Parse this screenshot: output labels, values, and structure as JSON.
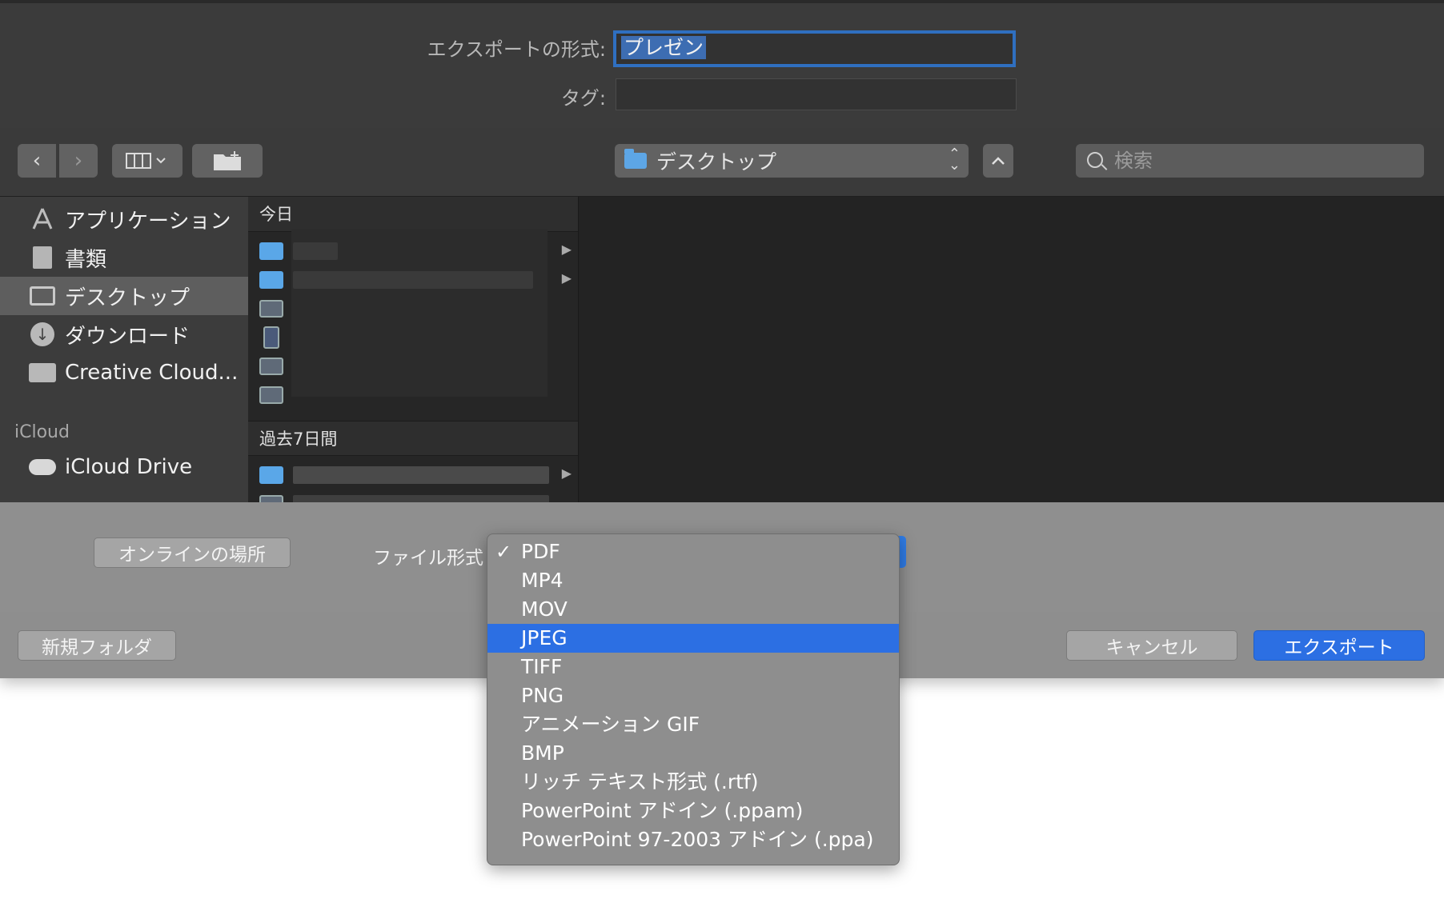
{
  "header": {
    "export_as_label": "エクスポートの形式:",
    "export_name": "プレゼン",
    "tags_label": "タグ:",
    "tags_value": ""
  },
  "toolbar": {
    "back_glyph": "‹",
    "forward_glyph": "›",
    "view_glyph": "▥⌄",
    "location": "デスクトップ",
    "search_placeholder": "検索"
  },
  "sidebar": {
    "items": [
      {
        "label": "アプリケーション",
        "icon": "applications-icon"
      },
      {
        "label": "書類",
        "icon": "documents-icon"
      },
      {
        "label": "デスクトップ",
        "icon": "desktop-icon"
      },
      {
        "label": "ダウンロード",
        "icon": "downloads-icon"
      },
      {
        "label": "Creative Cloud...",
        "icon": "folder-icon"
      }
    ],
    "icloud_section": "iCloud",
    "icloud_items": [
      {
        "label": "iCloud Drive",
        "icon": "cloud-icon"
      }
    ]
  },
  "browser": {
    "today_header": "今日",
    "last7_header": "過去7日間"
  },
  "options": {
    "online_locations_label": "オンラインの場所",
    "file_format_label": "ファイル形式"
  },
  "footer": {
    "new_folder_label": "新規フォルダ",
    "cancel_label": "キャンセル",
    "export_label": "エクスポート"
  },
  "format_menu": {
    "checked": "PDF",
    "highlighted": "JPEG",
    "items": [
      "PDF",
      "MP4",
      "MOV",
      "JPEG",
      "TIFF",
      "PNG",
      "アニメーション GIF",
      "BMP",
      "リッチ テキスト形式 (.rtf)",
      "PowerPoint アドイン (.ppam)",
      "PowerPoint 97-2003 アドイン (.ppa)"
    ]
  },
  "colors": {
    "accent": "#2c6fe3",
    "folder": "#5aa7e8"
  }
}
